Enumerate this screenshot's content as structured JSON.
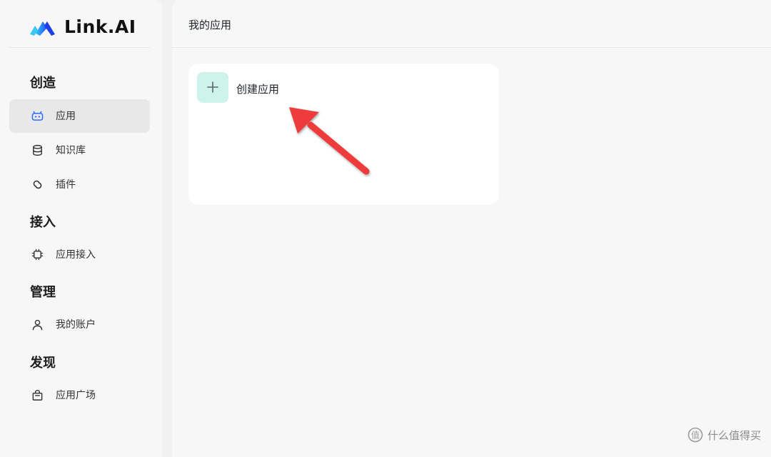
{
  "brand": {
    "name": "Link.AI"
  },
  "sidebar": {
    "sections": [
      {
        "title": "创造",
        "items": [
          {
            "label": "应用",
            "icon": "bot-icon",
            "active": true
          },
          {
            "label": "知识库",
            "icon": "database-icon"
          },
          {
            "label": "插件",
            "icon": "plugin-icon"
          }
        ]
      },
      {
        "title": "接入",
        "items": [
          {
            "label": "应用接入",
            "icon": "chip-icon"
          }
        ]
      },
      {
        "title": "管理",
        "items": [
          {
            "label": "我的账户",
            "icon": "user-icon"
          }
        ]
      },
      {
        "title": "发现",
        "items": [
          {
            "label": "应用广场",
            "icon": "shopping-bag-icon"
          }
        ]
      }
    ]
  },
  "main": {
    "title": "我的应用",
    "create_label": "创建应用"
  },
  "watermark": {
    "text": "什么值得买"
  },
  "colors": {
    "accent_blue": "#2f6bff",
    "create_tile": "#cdf3ea",
    "annotation_arrow": "#ee3b3b"
  }
}
